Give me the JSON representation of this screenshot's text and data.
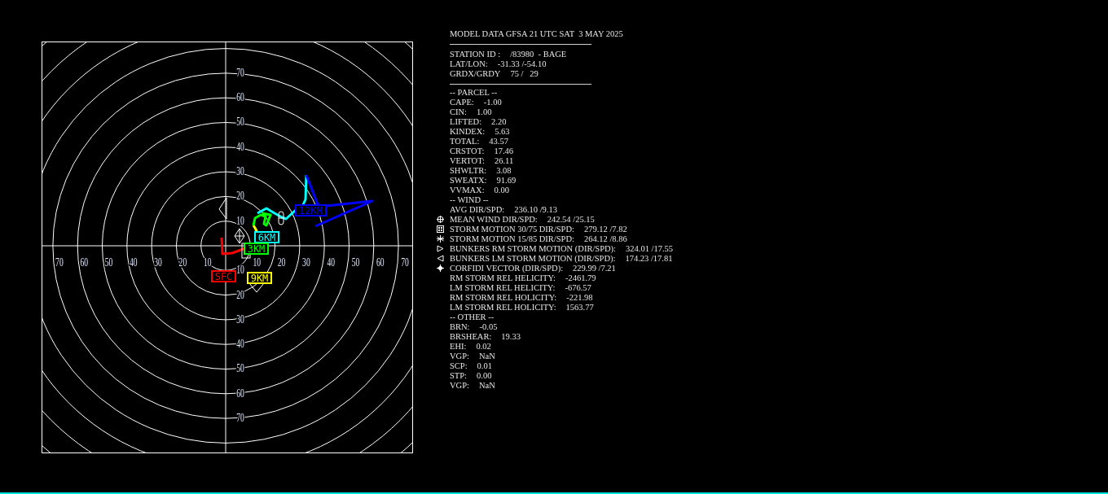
{
  "hodograph": {
    "ring_labels": {
      "north": [
        "70",
        "60",
        "50",
        "40",
        "30",
        "20",
        "10"
      ],
      "south": [
        "10",
        "20",
        "30",
        "40",
        "50",
        "60",
        "70"
      ],
      "west": [
        "70",
        "60",
        "50",
        "40",
        "30",
        "20",
        "10"
      ],
      "east": [
        "10",
        "20",
        "30",
        "40",
        "50",
        "60",
        "70"
      ]
    },
    "height_markers": [
      {
        "label": "SFC",
        "color": "#ff0000"
      },
      {
        "label": "6KM",
        "color": "#00ffff"
      },
      {
        "label": "3KM",
        "color": "#00ff00"
      },
      {
        "label": "9KM",
        "color": "#ffff00"
      },
      {
        "label": "12KM",
        "color": "#0000ff"
      }
    ]
  },
  "panel": {
    "title": "MODEL DATA GFSA 21 UTC SAT  3 MAY 2025",
    "station": [
      {
        "label": "STATION ID :",
        "value": "/83980  - BAGE"
      },
      {
        "label": "LAT/LON:",
        "value": "-31.33 /-54.10"
      },
      {
        "label": "GRDX/GRDY",
        "value": "75 /   29"
      }
    ],
    "rows": [
      {
        "kind": "heading",
        "label": "-- PARCEL --"
      },
      {
        "kind": "plain",
        "label": "CAPE:",
        "value": "-1.00"
      },
      {
        "kind": "plain",
        "label": "CIN:",
        "value": "1.00"
      },
      {
        "kind": "plain",
        "label": "LIFTED:",
        "value": "2.20"
      },
      {
        "kind": "plain",
        "label": "KINDEX:",
        "value": "5.63"
      },
      {
        "kind": "plain",
        "label": "TOTAL:",
        "value": "43.57"
      },
      {
        "kind": "plain",
        "label": "CRSTOT:",
        "value": "17.46"
      },
      {
        "kind": "plain",
        "label": "VERTOT:",
        "value": "26.11"
      },
      {
        "kind": "plain",
        "label": "SHWLTR:",
        "value": "3.08"
      },
      {
        "kind": "plain",
        "label": "SWEATX:",
        "value": "91.69"
      },
      {
        "kind": "plain",
        "label": "VVMAX:",
        "value": "0.00"
      },
      {
        "kind": "heading",
        "label": "-- WIND --"
      },
      {
        "kind": "plain",
        "label": "AVG DIR/SPD:",
        "value": "236.10 /9.13"
      },
      {
        "kind": "mean",
        "label": "MEAN WIND DIR/SPD:",
        "value": "242.54 /25.15"
      },
      {
        "kind": "square",
        "label": "STORM MOTION 30/75 DIR/SPD:",
        "value": "279.12 /7.82"
      },
      {
        "kind": "star",
        "label": "STORM MOTION 15/85 DIR/SPD:",
        "value": "264.12 /8.86"
      },
      {
        "kind": "right",
        "label": "BUNKERS RM STORM MOTION (DIR/SPD):",
        "value": "324.01 /17.55"
      },
      {
        "kind": "left",
        "label": "BUNKERS LM STORM MOTION (DIR/SPD):",
        "value": "174.23 /17.81"
      },
      {
        "kind": "diamond",
        "label": "CORFIDI VECTOR (DIR/SPD):",
        "value": "229.99 /7.21"
      },
      {
        "kind": "plain",
        "label": "RM STORM REL HELICITY:",
        "value": "-2461.79"
      },
      {
        "kind": "plain",
        "label": "LM STORM REL HELICITY:",
        "value": "-676.57"
      },
      {
        "kind": "plain",
        "label": "RM STORM REL HOLICITY:",
        "value": "-221.98"
      },
      {
        "kind": "plain",
        "label": "LM STORM REL HOLICITY:",
        "value": "1563.77"
      },
      {
        "kind": "heading",
        "label": "-- OTHER --"
      },
      {
        "kind": "plain",
        "label": "BRN:",
        "value": "-0.05"
      },
      {
        "kind": "plain",
        "label": "BRSHEAR:",
        "value": "19.33"
      },
      {
        "kind": "plain",
        "label": "EHI:",
        "value": "0.02"
      },
      {
        "kind": "plain",
        "label": "VGP:",
        "value": "NaN"
      },
      {
        "kind": "plain",
        "label": "SCP:",
        "value": "0.01"
      },
      {
        "kind": "plain",
        "label": "STP:",
        "value": "0.00"
      },
      {
        "kind": "plain",
        "label": "VGP:",
        "value": "NaN"
      }
    ]
  }
}
